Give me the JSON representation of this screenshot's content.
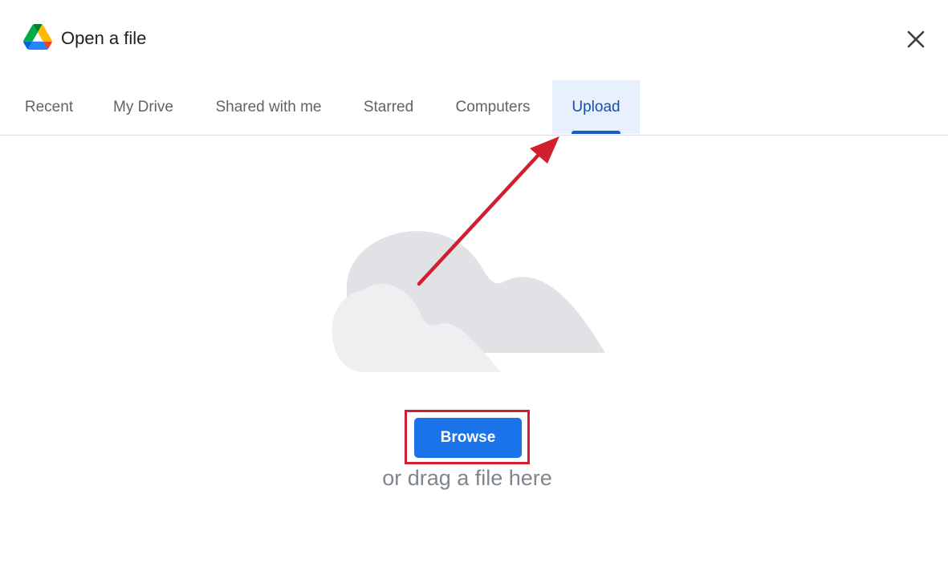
{
  "header": {
    "title": "Open a file",
    "logo_icon": "google-drive-logo",
    "close_icon": "close-icon"
  },
  "tabs": [
    {
      "label": "Recent",
      "active": false
    },
    {
      "label": "My Drive",
      "active": false
    },
    {
      "label": "Shared with me",
      "active": false
    },
    {
      "label": "Starred",
      "active": false
    },
    {
      "label": "Computers",
      "active": false
    },
    {
      "label": "Upload",
      "active": true
    }
  ],
  "upload": {
    "illustration_icon": "cloud-icon",
    "browse_label": "Browse",
    "drag_text": "or drag a file here"
  },
  "colors": {
    "accent": "#1a73e8",
    "active_tab_bg": "#e8f0fe",
    "active_tab_text": "#174ea6",
    "annotation": "#d0202f"
  }
}
